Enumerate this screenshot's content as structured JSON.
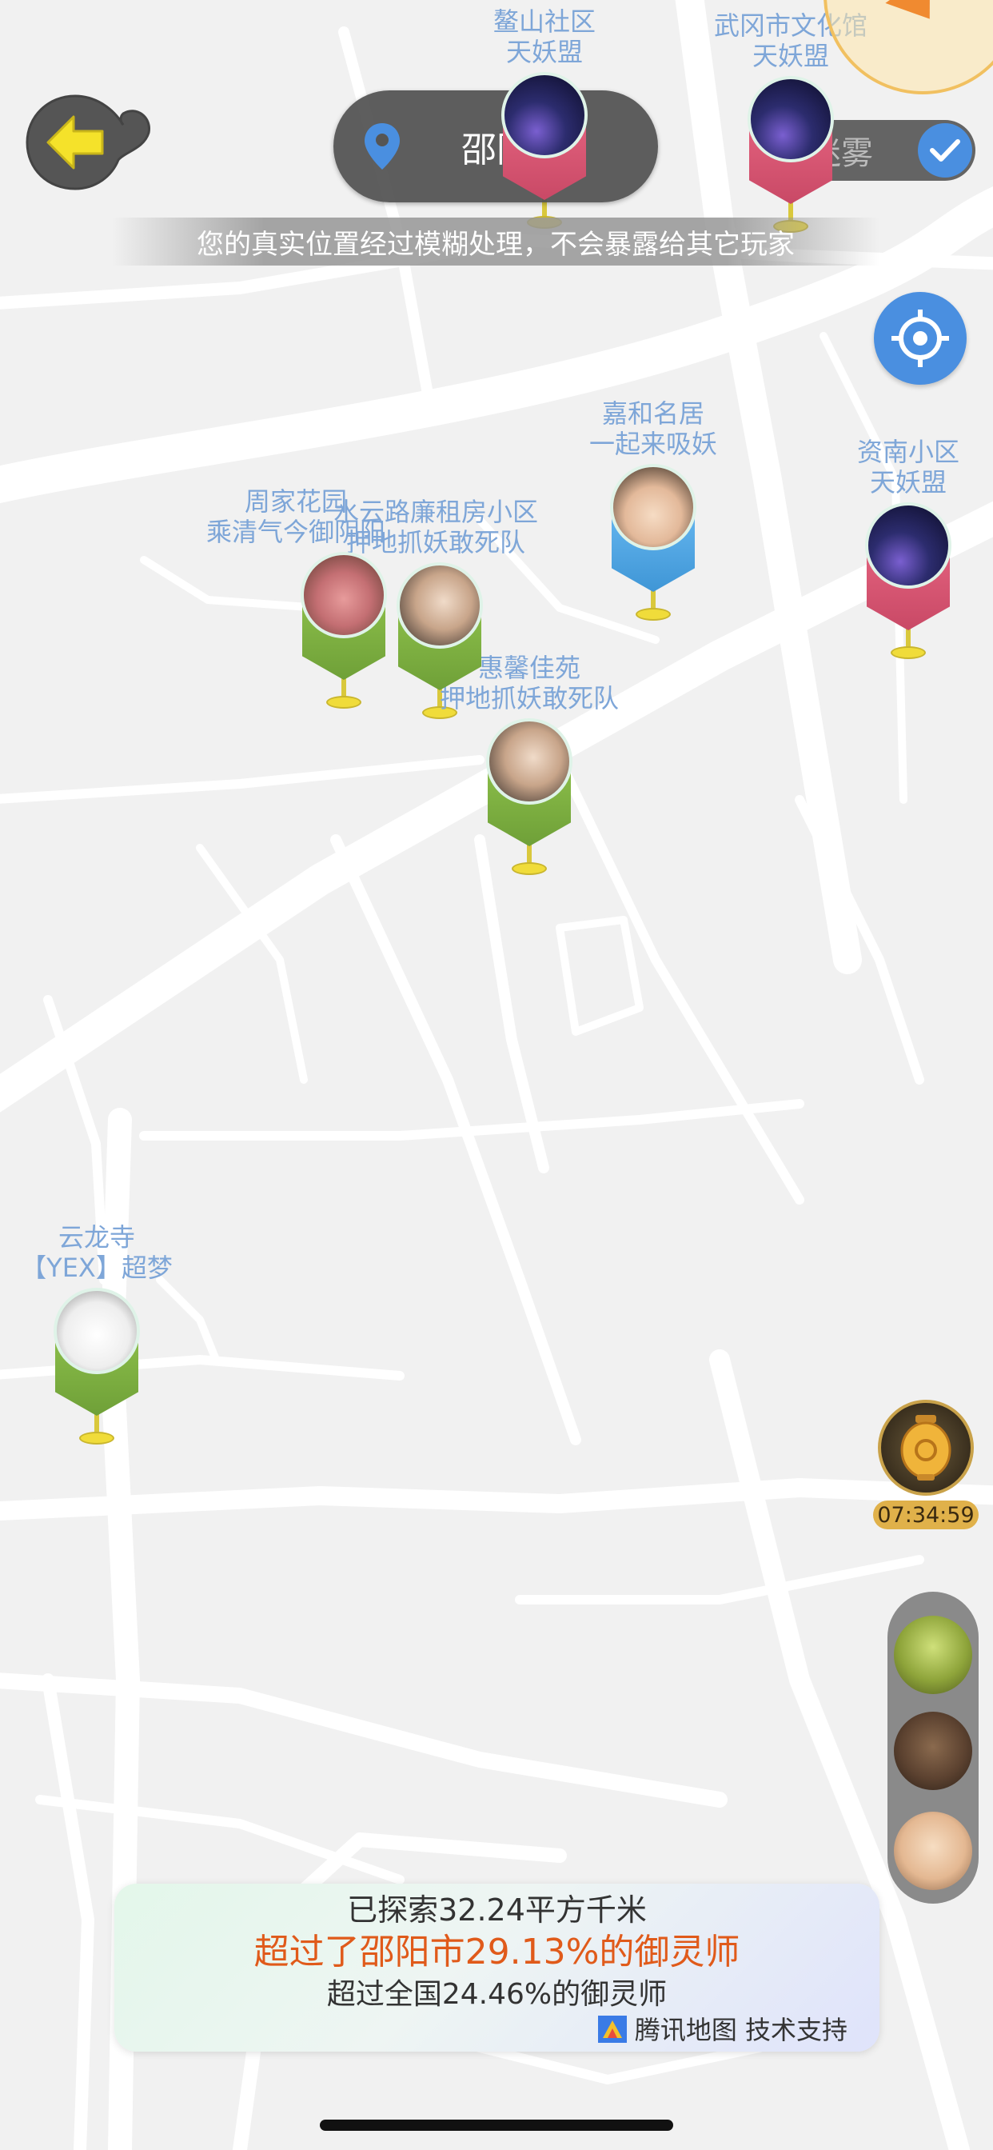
{
  "location": {
    "city": "邵阳市",
    "privacy_notice": "您的真实位置经过模糊处理，不会暴露给其它玩家"
  },
  "fog_toggle": {
    "label": "迷雾",
    "checked": true
  },
  "pins": [
    {
      "place": "鳌山社区",
      "group": "天妖盟",
      "color": "pink",
      "avatar": "space"
    },
    {
      "place": "武冈市文化馆",
      "group": "天妖盟",
      "color": "pink",
      "avatar": "space"
    },
    {
      "place": "嘉和名居",
      "group": "一起来吸妖",
      "color": "blue",
      "avatar": "girl"
    },
    {
      "place": "资南小区",
      "group": "天妖盟",
      "color": "pink",
      "avatar": "space"
    },
    {
      "place": "周家花园",
      "group": "乘清气今御阴阳",
      "color": "green",
      "avatar": "pig"
    },
    {
      "place": "水云路廉租房小区",
      "group": "押地抓妖敢死队",
      "color": "green",
      "avatar": "man"
    },
    {
      "place": "惠馨佳苑",
      "group": "押地抓妖敢死队",
      "color": "green",
      "avatar": "man"
    },
    {
      "place": "云龙寺",
      "group": "【YEX】超梦",
      "color": "green",
      "avatar": "sketch"
    }
  ],
  "timer": {
    "value": "07:34:59"
  },
  "stats": {
    "explored": "已探索32.24平方千米",
    "city_rank": "超过了邵阳市29.13%的御灵师",
    "national_rank": "超过全国24.46%的御灵师",
    "map_credit": "腾讯地图 技术支持"
  },
  "icons": {
    "back": "back-arrow-icon",
    "location": "location-pin-icon",
    "check": "checkmark-icon",
    "recenter": "locate-target-icon",
    "lantern": "lantern-icon",
    "tencent": "tencent-map-logo-icon"
  },
  "colors": {
    "accent_blue": "#4a8fe0",
    "rank_orange": "#e05a1a",
    "pin_label": "#7ea6d8",
    "timer_bg": "#e0b14a"
  }
}
